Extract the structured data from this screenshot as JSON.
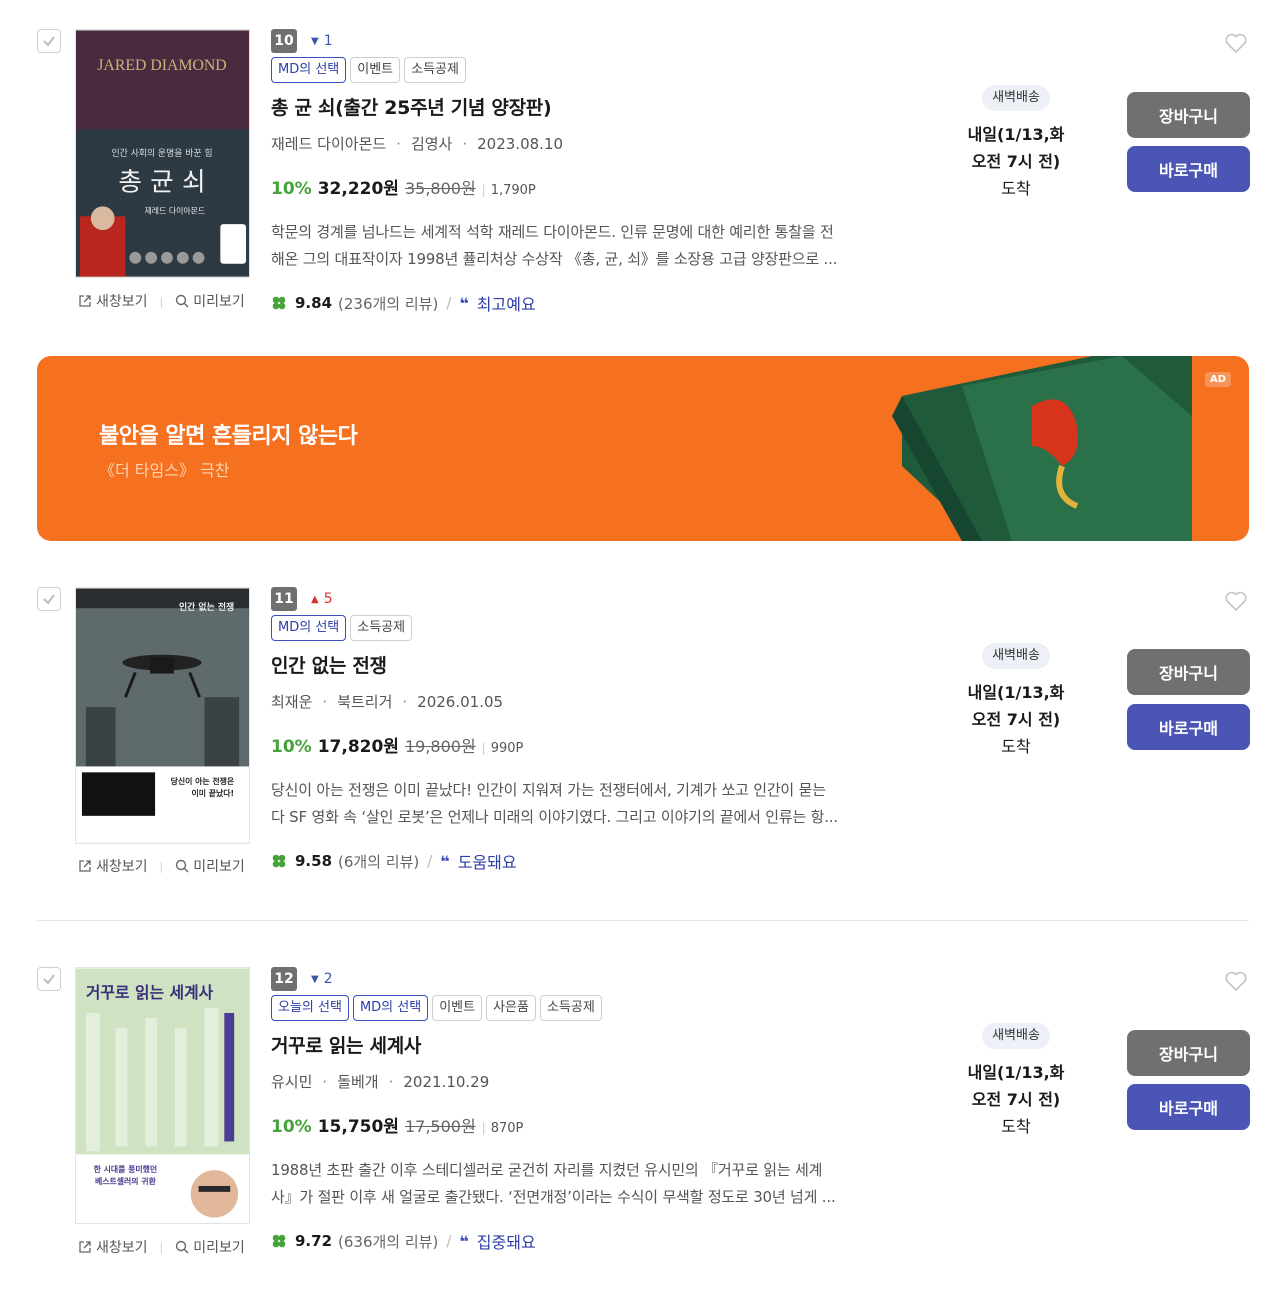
{
  "actions": {
    "new_window": "새창보기",
    "preview": "미리보기"
  },
  "colors": {
    "rate_green": "#44a33a",
    "buy_blue": "#4a55b6",
    "cart_gray": "#707070",
    "ad_orange": "#f5701f",
    "rank_up": "#d9332b",
    "rank_down": "#3b56a8"
  },
  "ad": {
    "headline": "불안을 알면 흔들리지 않는다",
    "sub": "《더 타임스》 극찬",
    "label": "AD"
  },
  "items": [
    {
      "rank": "10",
      "change_dir": "down",
      "change_symbol": "▼",
      "change_value": "1",
      "tags": [
        {
          "label": "MD의 선택",
          "hl": true
        },
        {
          "label": "이벤트",
          "hl": false
        },
        {
          "label": "소득공제",
          "hl": false
        }
      ],
      "title": "총 균 쇠(출간 25주년 기념 양장판)",
      "author": "재레드 다이아몬드",
      "publisher": "김영사",
      "date": "2023.08.10",
      "rate": "10%",
      "sale_price": "32,220원",
      "orig_price": "35,800원",
      "point": "1,790P",
      "desc1": "학문의 경계를 넘나드는 세계적 석학 재레드 다이아몬드. 인류 문명에 대한 예리한 통찰을 전",
      "desc2": "해온 그의 대표작이자 1998년 퓰리처상 수상작 《총, 균, 쇠》를 소장용 고급 양장판으로 ...",
      "score": "9.84",
      "review_count": "(236개의 리뷰)",
      "keyword": "최고예요",
      "delivery_badge": "새벽배송",
      "delivery_line1": "내일(1/13,화",
      "delivery_line2": "오전 7시 전)",
      "delivery_line3": "도착",
      "cart": "장바구니",
      "buy": "바로구매",
      "cover": {
        "author_en": "JARED DIAMOND",
        "subtitle": "인간 사회의 운명을 바꾼 힘",
        "title": "총 균 쇠",
        "author_ko": "재레드 다이아몬드"
      }
    },
    {
      "rank": "11",
      "change_dir": "up",
      "change_symbol": "▲",
      "change_value": "5",
      "tags": [
        {
          "label": "MD의 선택",
          "hl": true
        },
        {
          "label": "소득공제",
          "hl": false
        }
      ],
      "title": "인간 없는 전쟁",
      "author": "최재운",
      "publisher": "북트리거",
      "date": "2026.01.05",
      "rate": "10%",
      "sale_price": "17,820원",
      "orig_price": "19,800원",
      "point": "990P",
      "desc1": "당신이 아는 전쟁은 이미 끝났다! 인간이 지워져 가는 전쟁터에서, 기계가 쏘고 인간이 묻는",
      "desc2": "다 SF 영화 속 ‘살인 로봇’은 언제나 미래의 이야기였다. 그리고 이야기의 끝에서 인류는 항...",
      "score": "9.58",
      "review_count": "(6개의 리뷰)",
      "keyword": "도움돼요",
      "delivery_badge": "새벽배송",
      "delivery_line1": "내일(1/13,화",
      "delivery_line2": "오전 7시 전)",
      "delivery_line3": "도착",
      "cart": "장바구니",
      "buy": "바로구매",
      "cover": {
        "title": "인간 없는 전쟁",
        "tagline1": "당신이 아는 전쟁은",
        "tagline2": "이미 끝났다!"
      }
    },
    {
      "rank": "12",
      "change_dir": "down",
      "change_symbol": "▼",
      "change_value": "2",
      "tags": [
        {
          "label": "오늘의 선택",
          "hl": true
        },
        {
          "label": "MD의 선택",
          "hl": true
        },
        {
          "label": "이벤트",
          "hl": false
        },
        {
          "label": "사은품",
          "hl": false
        },
        {
          "label": "소득공제",
          "hl": false
        }
      ],
      "title": "거꾸로 읽는 세계사",
      "author": "유시민",
      "publisher": "돌베개",
      "date": "2021.10.29",
      "rate": "10%",
      "sale_price": "15,750원",
      "orig_price": "17,500원",
      "point": "870P",
      "desc1": "1988년 초판 출간 이후 스테디셀러로 굳건히 자리를 지켰던 유시민의 『거꾸로 읽는 세계",
      "desc2": "사』가 절판 이후 새 얼굴로 출간됐다. ‘전면개정’이라는 수식이 무색할 정도로 30년 넘게 ...",
      "score": "9.72",
      "review_count": "(636개의 리뷰)",
      "keyword": "집중돼요",
      "delivery_badge": "새벽배송",
      "delivery_line1": "내일(1/13,화",
      "delivery_line2": "오전 7시 전)",
      "delivery_line3": "도착",
      "cart": "장바구니",
      "buy": "바로구매",
      "cover": {
        "title": "거꾸로 읽는 세계사",
        "blurb1": "한 시대를 풍미했던",
        "blurb2": "베스트셀러의 귀환"
      }
    }
  ]
}
